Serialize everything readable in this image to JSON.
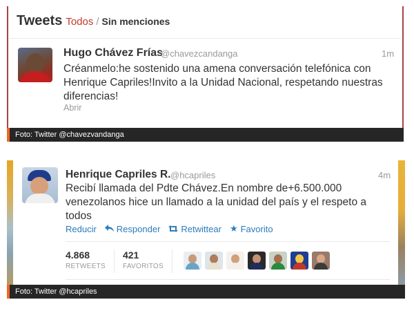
{
  "shot1": {
    "header": {
      "title": "Tweets",
      "filter_all": "Todos",
      "separator": "/",
      "filter_no_mentions": "Sin menciones"
    },
    "tweet": {
      "name": "Hugo Chávez Frías",
      "handle": "@chavezcandanga",
      "time": "1m",
      "text": "Créanmelo:he sostenido una amena conversación telefónica con Henrique Capriles!Invito a la Unidad Nacional, respetando nuestras diferencias!",
      "expand": "Abrir"
    },
    "caption": "Foto: Twitter @chavezvandanga"
  },
  "shot2": {
    "tweet": {
      "name": "Henrique Capriles R.",
      "handle": "@hcapriles",
      "time": "4m",
      "text": "Recibí llamada del Pdte Chávez.En nombre de+6.500.000 venezolanos hice un llamado a la unidad del país y el respeto a todos",
      "actions": {
        "collapse": "Reducir",
        "reply": "Responder",
        "retweet": "Retwittear",
        "favorite": "Favorito"
      },
      "stats": {
        "retweets": {
          "value": "4.868",
          "label": "RETWEETS"
        },
        "favorites": {
          "value": "421",
          "label": "FAVORITOS"
        }
      },
      "favoriters": [
        {
          "head": "#c89a7a",
          "body": "#6aa3c8",
          "bg": "#e9eef3"
        },
        {
          "head": "#b07c5c",
          "body": "#e8e0d0",
          "bg": "#dfe6ea"
        },
        {
          "head": "#d2a07c",
          "body": "#f3efe9",
          "bg": "#f4f1ec"
        },
        {
          "head": "#c69074",
          "body": "#1f2d5a",
          "bg": "#2a2a2a"
        },
        {
          "head": "#a56e4f",
          "body": "#2c8a3e",
          "bg": "#c9d2c6"
        },
        {
          "head": "#f4c64a",
          "body": "#c0392b",
          "bg": "#1f3f8f"
        },
        {
          "head": "#d7a989",
          "body": "#3a3a3a",
          "bg": "#9a7a68"
        }
      ]
    },
    "caption": "Foto: Twitter @hcapriles"
  }
}
